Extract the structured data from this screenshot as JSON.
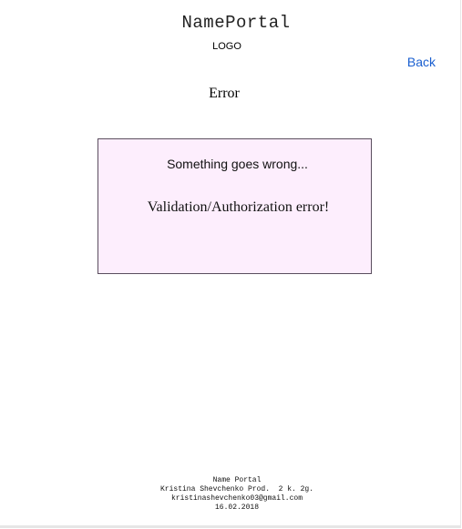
{
  "header": {
    "site_title": "NamePortal",
    "logo_text": "LOGO",
    "back_label": "Back"
  },
  "main": {
    "heading": "Error",
    "error_box": {
      "message": "Something goes wrong...",
      "detail": "Validation/Authorization error!"
    }
  },
  "footer": {
    "name": "Name Portal",
    "credit": "Kristina Shevchenko Prod.  2 k. 2g.",
    "email": "kristinashevchenko03@gmail.com",
    "date": "16.02.2018"
  },
  "colors": {
    "link": "#1a5fd0",
    "error_box_background": "#fdeefd",
    "error_box_border": "#5a4d5e"
  }
}
